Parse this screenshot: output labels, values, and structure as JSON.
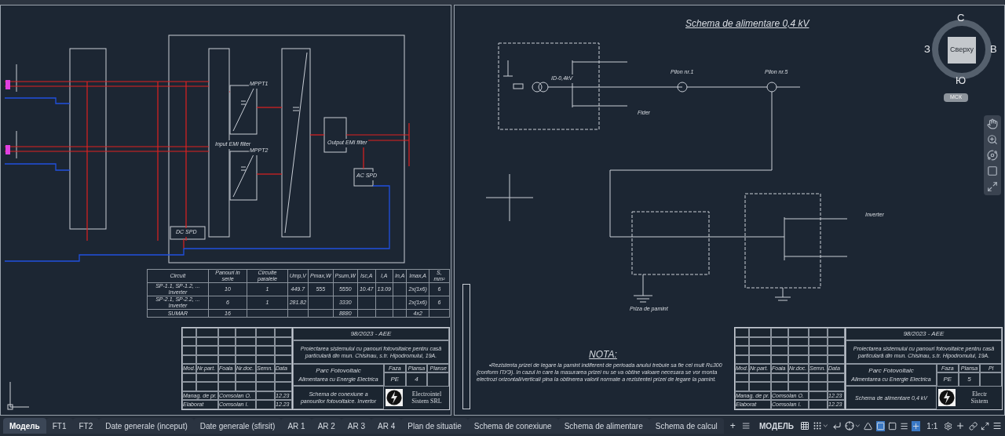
{
  "left_sheet": {
    "labels": [
      "Input EMI filter",
      "MPPT1",
      "MPPT2",
      "Output EMI filter",
      "AC SPD",
      "DC SPD"
    ],
    "table": {
      "columns": [
        "Circuit",
        "Panouri in serie",
        "Circuite paralele",
        "Ump,V",
        "Pmax,W",
        "Psum,W",
        "Isc,A",
        "I,A",
        "In,A",
        "Imax,A",
        "S, mm²"
      ],
      "rows": [
        [
          "SP-1.1, SP-1.2, ... Inverter",
          "10",
          "1",
          "449.7",
          "555",
          "5550",
          "10.47",
          "13.09",
          "",
          "2x(1x6)",
          "6"
        ],
        [
          "SP-2.1, SP-2.2, ... Inverter",
          "6",
          "1",
          "281.82",
          "",
          "3330",
          "",
          "",
          "",
          "2x(1x6)",
          "6"
        ],
        [
          "SUMAR",
          "16",
          "",
          "",
          "",
          "8880",
          "",
          "",
          "",
          "4x2",
          ""
        ]
      ]
    },
    "title_block": {
      "code": "98/2023 - AEE",
      "project": "Proiectarea sistemului cu panouri fotovoltaice pentru casă particulară din mun. Chisinau, s.tr. Hipodromului, 19A.",
      "object": "Parc Fotovoltaic",
      "object_sub": "Alimentarea cu Energie Electrica",
      "stage_headers": [
        "Faza",
        "Plansa",
        "Planse"
      ],
      "stage_values": [
        "PE",
        "4"
      ],
      "sheet_title": "Schema de conexiune a panourilor fotovoltaice. Invertor",
      "company": [
        "Electrointel",
        "Sistem SRL"
      ],
      "grid_headers": [
        "Mod.",
        "Nr.part.",
        "Foaia",
        "Nr.doc.",
        "Semn.",
        "Data"
      ],
      "staff": [
        [
          "Manag. de pr.",
          "Comsolan O.",
          "12.23"
        ],
        [
          "Elaborat",
          "Comsolan I.",
          "12.23"
        ]
      ]
    }
  },
  "right_sheet": {
    "title": "Schema de alimentare 0,4 kV",
    "labels": [
      "ID-0,4kV",
      "Pilon nr.1",
      "Pilon nr.5",
      "Fider",
      "Inverter",
      "Priza de pamint"
    ],
    "nota": {
      "heading": "NOTA:",
      "text": "•Rezistenta prizei de legare la pamint indiferent de perioada anului trebuie sa fie cel mult R≤300 (conform ПУЭ). In cazul in care la masurarea prizei nu se va obtine valoare necesara se vor monta electrozi orizontali/verticali pina la obtinerea valorii normate a rezistentei prizei de legare la pamint."
    },
    "title_block": {
      "code": "98/2023 - AEE",
      "project": "Proiectarea sistemului cu panouri fotovoltaice pentru casă particulară din mun. Chisinau, s.tr. Hipodromului, 19A.",
      "object": "Parc Fotovoltaic",
      "object_sub": "Alimentarea cu Energie Electrica",
      "stage_headers": [
        "Faza",
        "Plansa",
        "Pl"
      ],
      "stage_values": [
        "PE",
        "5"
      ],
      "sheet_title": "Schema de alimentare 0,4 kV",
      "company": [
        "Electr",
        "Sistem"
      ],
      "grid_headers": [
        "Mod.",
        "Nr.part.",
        "Foaia",
        "Nr.doc.",
        "Semn.",
        "Data"
      ],
      "staff": [
        [
          "Manag. de pr.",
          "Comsolan O.",
          "12.23"
        ],
        [
          "Elaborat",
          "Comsolan I.",
          "12.23"
        ]
      ]
    }
  },
  "viewcube": {
    "north": "С",
    "west": "З",
    "east": "В",
    "south": "Ю",
    "face": "Сверху",
    "ucs": "МСК"
  },
  "layout_tabs": [
    {
      "label": "Модель",
      "selected": true
    },
    {
      "label": "FT1",
      "selected": false
    },
    {
      "label": "FT2",
      "selected": false
    },
    {
      "label": "Date generale (inceput)",
      "selected": false
    },
    {
      "label": "Date generale (sfirsit)",
      "selected": false
    },
    {
      "label": "AR 1",
      "selected": false
    },
    {
      "label": "AR 2",
      "selected": false
    },
    {
      "label": "AR 3",
      "selected": false
    },
    {
      "label": "AR 4",
      "selected": false
    },
    {
      "label": "Plan de situatie",
      "selected": false
    },
    {
      "label": "Schema de conexiune",
      "selected": false
    },
    {
      "label": "Schema de alimentare",
      "selected": false
    },
    {
      "label": "Schema de calcul",
      "selected": false
    }
  ],
  "add_tab": "+",
  "status_bar": {
    "model_label": "МОДЕЛЬ",
    "scale": "1:1"
  }
}
